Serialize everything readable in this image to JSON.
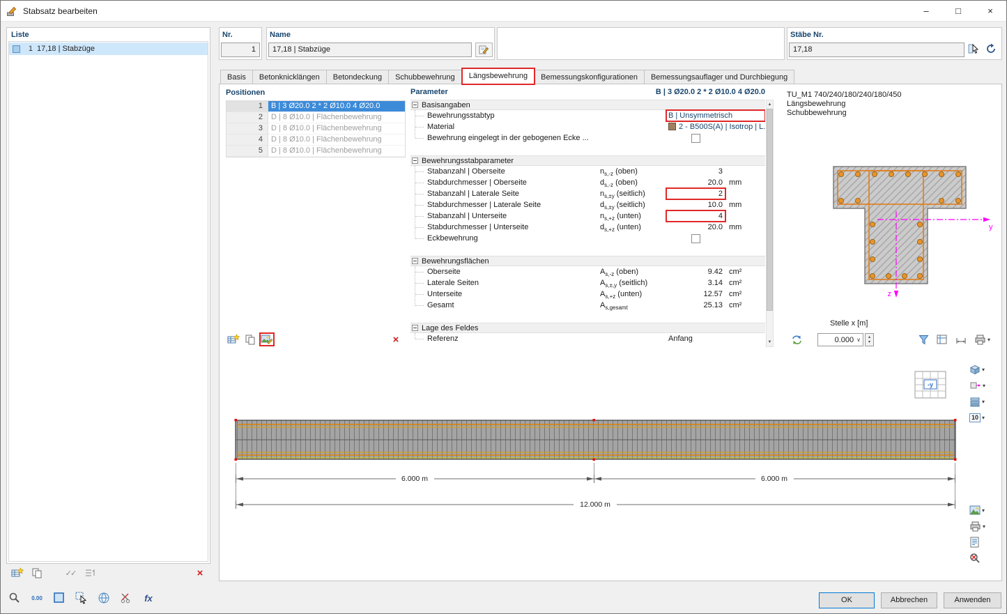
{
  "window": {
    "title": "Stabsatz bearbeiten"
  },
  "icons": {
    "minimize": "–",
    "maximize": "□",
    "close": "×",
    "dropdown": "▾",
    "combo_arrow": "∨",
    "spin_up": "▴",
    "spin_down": "▾",
    "scroll_up": "▲",
    "scroll_down": "▼",
    "delete": "×",
    "checks": "✓✓"
  },
  "liste": {
    "label": "Liste",
    "row": {
      "num": "1",
      "text": "17,18 | Stabzüge"
    }
  },
  "fields": {
    "nr_label": "Nr.",
    "nr_value": "1",
    "name_label": "Name",
    "name_value": "17,18 | Stabzüge",
    "staebe_label": "Stäbe Nr.",
    "staebe_value": "17,18"
  },
  "tabs": [
    "Basis",
    "Betonknicklängen",
    "Betondeckung",
    "Schubbewehrung",
    "Längsbewehrung",
    "Bemessungskonfigurationen",
    "Bemessungsauflager und Durchbiegung"
  ],
  "positionen": {
    "label": "Positionen",
    "rows": [
      {
        "n": "1",
        "t": "B | 3 Ø20.0 2 * 2 Ø10.0 4 Ø20.0"
      },
      {
        "n": "2",
        "t": "D | 8 Ø10.0 | Flächenbewehrung"
      },
      {
        "n": "3",
        "t": "D | 8 Ø10.0 | Flächenbewehrung"
      },
      {
        "n": "4",
        "t": "D | 8 Ø10.0 | Flächenbewehrung"
      },
      {
        "n": "5",
        "t": "D | 8 Ø10.0 | Flächenbewehrung"
      }
    ]
  },
  "parameter": {
    "label": "Parameter",
    "selection": "B | 3 Ø20.0 2 * 2 Ø10.0 4 Ø20.0",
    "sec_basis": "Basisangaben",
    "basis": {
      "stabtyp_label": "Bewehrungsstabtyp",
      "stabtyp_value": "B | Unsymmetrisch",
      "material_label": "Material",
      "material_value": "2 - B500S(A) | Isotrop | L...",
      "ecke_label": "Bewehrung eingelegt in der gebogenen Ecke ..."
    },
    "sec_stab": "Bewehrungsstabparameter",
    "stab": {
      "rows": [
        {
          "label": "Stabanzahl | Oberseite",
          "sym": "n",
          "sub": "s,-z",
          "suffix": " (oben)",
          "value": "3",
          "unit": ""
        },
        {
          "label": "Stabdurchmesser | Oberseite",
          "sym": "d",
          "sub": "s,-z",
          "suffix": " (oben)",
          "value": "20.0",
          "unit": "mm"
        },
        {
          "label": "Stabanzahl | Laterale Seite",
          "sym": "n",
          "sub": "s,±y",
          "suffix": " (seitlich)",
          "value": "2",
          "unit": ""
        },
        {
          "label": "Stabdurchmesser | Laterale Seite",
          "sym": "d",
          "sub": "s,±y",
          "suffix": " (seitlich)",
          "value": "10.0",
          "unit": "mm"
        },
        {
          "label": "Stabanzahl | Unterseite",
          "sym": "n",
          "sub": "s,+z",
          "suffix": " (unten)",
          "value": "4",
          "unit": ""
        },
        {
          "label": "Stabdurchmesser | Unterseite",
          "sym": "d",
          "sub": "s,+z",
          "suffix": " (unten)",
          "value": "20.0",
          "unit": "mm"
        }
      ],
      "eck_label": "Eckbewehrung"
    },
    "sec_flaechen": "Bewehrungsflächen",
    "flaechen": {
      "rows": [
        {
          "label": "Oberseite",
          "sym": "A",
          "sub": "s,-z",
          "suffix": " (oben)",
          "value": "9.42",
          "unit": "cm²"
        },
        {
          "label": "Laterale Seiten",
          "sym": "A",
          "sub": "s,±,y",
          "suffix": " (seitlich)",
          "value": "3.14",
          "unit": "cm²"
        },
        {
          "label": "Unterseite",
          "sym": "A",
          "sub": "s,+z",
          "suffix": " (unten)",
          "value": "12.57",
          "unit": "cm²"
        },
        {
          "label": "Gesamt",
          "sym": "A",
          "sub": "s,gesamt",
          "suffix": "",
          "value": "25.13",
          "unit": "cm²"
        }
      ]
    },
    "sec_lage": "Lage des Feldes",
    "lage": {
      "referenz_label": "Referenz",
      "referenz_value": "Anfang"
    }
  },
  "preview": {
    "title": "TU_M1 740/240/180/240/180/450",
    "line2": "Längsbewehrung",
    "line3": "Schubbewehrung",
    "axis_y": "y",
    "axis_z": "z",
    "stelle_label": "Stelle x [m]",
    "stelle_value": "0.000"
  },
  "beam": {
    "dim_left": "6.000 m",
    "dim_right": "6.000 m",
    "dim_total": "12.000 m",
    "axis_indicator": "-y",
    "numbering_icon": "10"
  },
  "footer": {
    "decimals_label": "0.00",
    "fx_label": "fx",
    "ok": "OK",
    "cancel": "Abbrechen",
    "apply": "Anwenden"
  }
}
